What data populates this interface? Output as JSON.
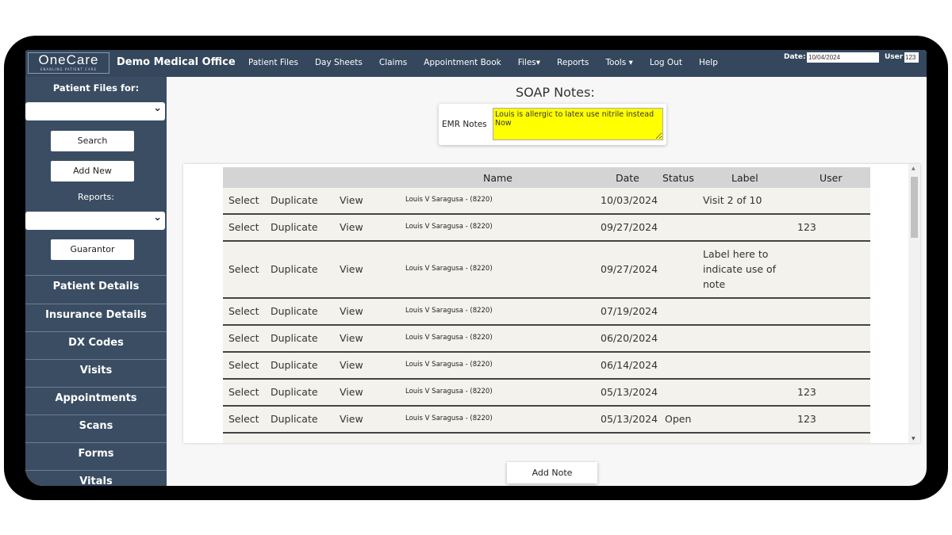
{
  "header": {
    "logo": "OneCare",
    "logo_tagline": "ENABLING PATIENT CARE",
    "office": "Demo Medical Office",
    "nav": [
      "Patient Files",
      "Day Sheets",
      "Claims",
      "Appointment Book",
      "Files▾",
      "Reports",
      "Tools ▾",
      "Log Out",
      "Help"
    ],
    "date_label": "Date:",
    "date_value": "10/04/2024",
    "user_label": "User",
    "user_value": "123"
  },
  "sidebar": {
    "patient_files_for": "Patient Files for:",
    "search": "Search",
    "add_new": "Add New",
    "reports": "Reports:",
    "guarantor": "Guarantor",
    "items": [
      "Patient Details",
      "Insurance Details",
      "DX Codes",
      "Visits",
      "Appointments",
      "Scans",
      "Forms",
      "Vitals"
    ]
  },
  "main": {
    "title": "SOAP Notes:",
    "emr_label": "EMR Notes",
    "emr_value": "Louis is allergic to latex use nitrile instead\nNow",
    "columns": [
      "Name",
      "Date",
      "Status",
      "Label",
      "User"
    ],
    "actions": [
      "Select",
      "Duplicate",
      "View"
    ],
    "rows": [
      {
        "name": "Louis V Saragusa - (8220)",
        "date": "10/03/2024",
        "status": "",
        "label": "Visit 2 of 10",
        "user": ""
      },
      {
        "name": "Louis V Saragusa - (8220)",
        "date": "09/27/2024",
        "status": "",
        "label": "",
        "user": "123"
      },
      {
        "name": "Louis V Saragusa - (8220)",
        "date": "09/27/2024",
        "status": "",
        "label": "Label here to indicate use of note",
        "user": ""
      },
      {
        "name": "Louis V Saragusa - (8220)",
        "date": "07/19/2024",
        "status": "",
        "label": "",
        "user": ""
      },
      {
        "name": "Louis V Saragusa - (8220)",
        "date": "06/20/2024",
        "status": "",
        "label": "",
        "user": ""
      },
      {
        "name": "Louis V Saragusa - (8220)",
        "date": "06/14/2024",
        "status": "",
        "label": "",
        "user": ""
      },
      {
        "name": "Louis V Saragusa - (8220)",
        "date": "05/13/2024",
        "status": "",
        "label": "",
        "user": "123"
      },
      {
        "name": "Louis V Saragusa - (8220)",
        "date": "05/13/2024",
        "status": "Open",
        "label": "",
        "user": "123"
      }
    ],
    "add_note": "Add Note"
  }
}
